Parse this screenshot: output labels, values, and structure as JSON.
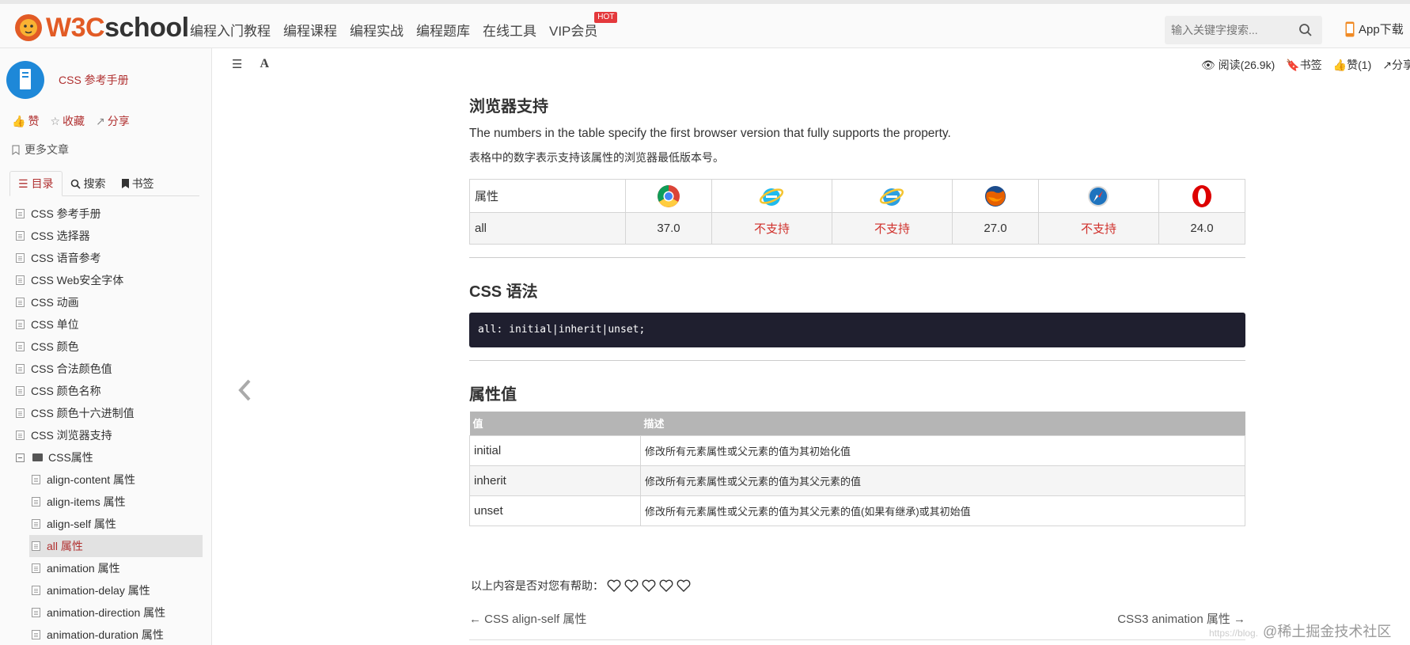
{
  "header": {
    "logo_w3c": "W3C",
    "logo_school": "school",
    "nav": [
      "编程入门教程",
      "编程课程",
      "编程实战",
      "编程题库",
      "在线工具",
      "VIP会员"
    ],
    "hot_badge": "HOT",
    "search_placeholder": "输入关键字搜索...",
    "app_download": "App下载"
  },
  "sidebar": {
    "book_title": "CSS 参考手册",
    "like": "赞",
    "favorite": "收藏",
    "share": "分享",
    "more_articles": "更多文章",
    "tabs": [
      "目录",
      "搜索",
      "书签"
    ],
    "toc": [
      "CSS 参考手册",
      "CSS 选择器",
      "CSS 语音参考",
      "CSS Web安全字体",
      "CSS 动画",
      "CSS 单位",
      "CSS 颜色",
      "CSS 合法颜色值",
      "CSS 颜色名称",
      "CSS 颜色十六进制值",
      "CSS 浏览器支持"
    ],
    "folder": "CSS属性",
    "sub_items": [
      "align-content 属性",
      "align-items 属性",
      "align-self 属性",
      "all 属性",
      "animation 属性",
      "animation-delay 属性",
      "animation-direction 属性",
      "animation-duration 属性"
    ],
    "active_item": "all 属性"
  },
  "toolbar": {
    "reads": "阅读(26.9k)",
    "bookmark": "书签",
    "likes": "赞(1)",
    "share": "分享"
  },
  "content": {
    "browser_support_title": "浏览器支持",
    "p_en": "The numbers in the table specify the first browser version that fully supports the property.",
    "p_cn": "表格中的数字表示支持该属性的浏览器最低版本号。",
    "browser_table": {
      "header_label": "属性",
      "row_label": "all",
      "browsers": [
        "chrome-icon",
        "ie-icon",
        "edge-icon",
        "firefox-icon",
        "safari-icon",
        "opera-icon"
      ],
      "values": [
        "37.0",
        "不支持",
        "不支持",
        "27.0",
        "不支持",
        "24.0"
      ]
    },
    "syntax_title": "CSS 语法",
    "syntax_code": "all: initial|inherit|unset;",
    "values_title": "属性值",
    "values_table": {
      "headers": [
        "值",
        "描述"
      ],
      "rows": [
        [
          "initial",
          "修改所有元素属性或父元素的值为其初始化值"
        ],
        [
          "inherit",
          "修改所有元素属性或父元素的值为其父元素的值"
        ],
        [
          "unset",
          "修改所有元素属性或父元素的值为其父元素的值(如果有继承)或其初始值"
        ]
      ]
    },
    "helpful": "以上内容是否对您有帮助：",
    "prev_link": "← CSS align-self 属性",
    "next_link": "CSS3 animation 属性 →"
  },
  "watermark": "@稀土掘金技术社区",
  "watermark_faint": "https://blog.",
  "colors": {
    "brand": "#e25b25",
    "accent": "#b03030",
    "not_supported": "#d0302b",
    "code_bg": "#1f1f2f"
  }
}
